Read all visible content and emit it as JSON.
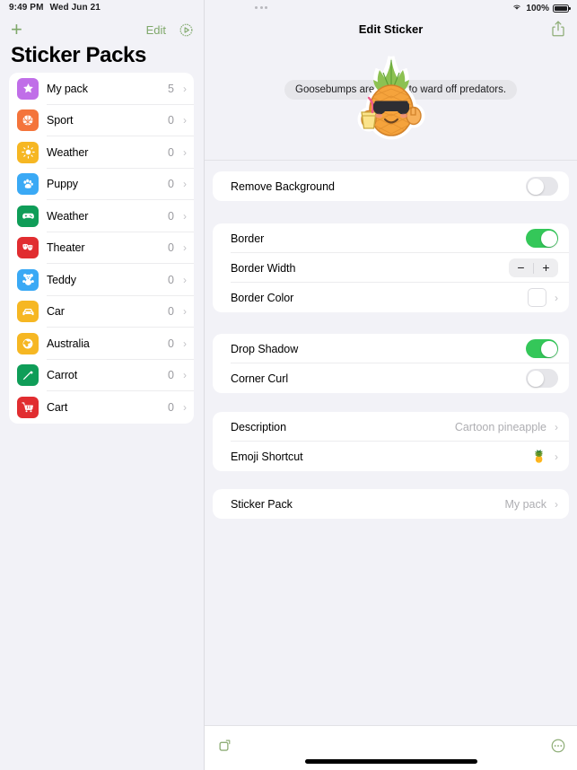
{
  "status_bar": {
    "time": "9:49 PM",
    "date": "Wed Jun 21",
    "battery_percent": "100%",
    "wifi_icon": "wifi-icon",
    "battery_icon": "battery-full-icon",
    "multitask_icon": "multitask-dots-icon"
  },
  "sidebar": {
    "add_label": "+",
    "edit_label": "Edit",
    "action_icon": "gear-play-icon",
    "title": "Sticker Packs",
    "packs": [
      {
        "label": "My pack",
        "count": "5",
        "icon": "star-icon",
        "color": "#c06ee8"
      },
      {
        "label": "Sport",
        "count": "0",
        "icon": "basketball-icon",
        "color": "#f4743b"
      },
      {
        "label": "Weather",
        "count": "0",
        "icon": "sun-icon",
        "color": "#f6b723"
      },
      {
        "label": "Puppy",
        "count": "0",
        "icon": "paw-icon",
        "color": "#3aa9f5"
      },
      {
        "label": "Weather",
        "count": "0",
        "icon": "gamepad-icon",
        "color": "#0f9d58"
      },
      {
        "label": "Theater",
        "count": "0",
        "icon": "theater-masks-icon",
        "color": "#e12d30"
      },
      {
        "label": "Teddy",
        "count": "0",
        "icon": "teddy-bear-icon",
        "color": "#3aa9f5"
      },
      {
        "label": "Car",
        "count": "0",
        "icon": "car-icon",
        "color": "#f6b723"
      },
      {
        "label": "Australia",
        "count": "0",
        "icon": "globe-icon",
        "color": "#f6b723"
      },
      {
        "label": "Carrot",
        "count": "0",
        "icon": "carrot-icon",
        "color": "#0f9d58"
      },
      {
        "label": "Cart",
        "count": "0",
        "icon": "shopping-cart-icon",
        "color": "#e12d30"
      }
    ]
  },
  "detail": {
    "title": "Edit Sticker",
    "share_icon": "share-icon",
    "preview": {
      "bubble_text": "Goosebumps are meant to ward off predators.",
      "sticker_icon": "pineapple-sticker"
    },
    "groups": [
      {
        "rows": [
          {
            "label": "Remove Background",
            "control": "toggle",
            "state": "off"
          }
        ]
      },
      {
        "rows": [
          {
            "label": "Border",
            "control": "toggle",
            "state": "on"
          },
          {
            "label": "Border Width",
            "control": "stepper",
            "minus": "−",
            "plus": "+"
          },
          {
            "label": "Border Color",
            "control": "color",
            "swatch": "#ffffff"
          }
        ]
      },
      {
        "rows": [
          {
            "label": "Drop Shadow",
            "control": "toggle",
            "state": "on"
          },
          {
            "label": "Corner Curl",
            "control": "toggle",
            "state": "off"
          }
        ]
      },
      {
        "rows": [
          {
            "label": "Description",
            "control": "value",
            "value": "Cartoon pineapple"
          },
          {
            "label": "Emoji Shortcut",
            "control": "emoji",
            "value": "🍍"
          }
        ]
      },
      {
        "rows": [
          {
            "label": "Sticker Pack",
            "control": "value",
            "value": "My pack"
          }
        ]
      }
    ],
    "bottom_bar": {
      "left_icon": "rotate-square-icon",
      "right_icon": "more-circle-icon"
    }
  },
  "colors": {
    "accent_green": "#7fa86a",
    "toggle_on": "#34c759",
    "background": "#f2f2f7",
    "card": "#ffffff"
  }
}
